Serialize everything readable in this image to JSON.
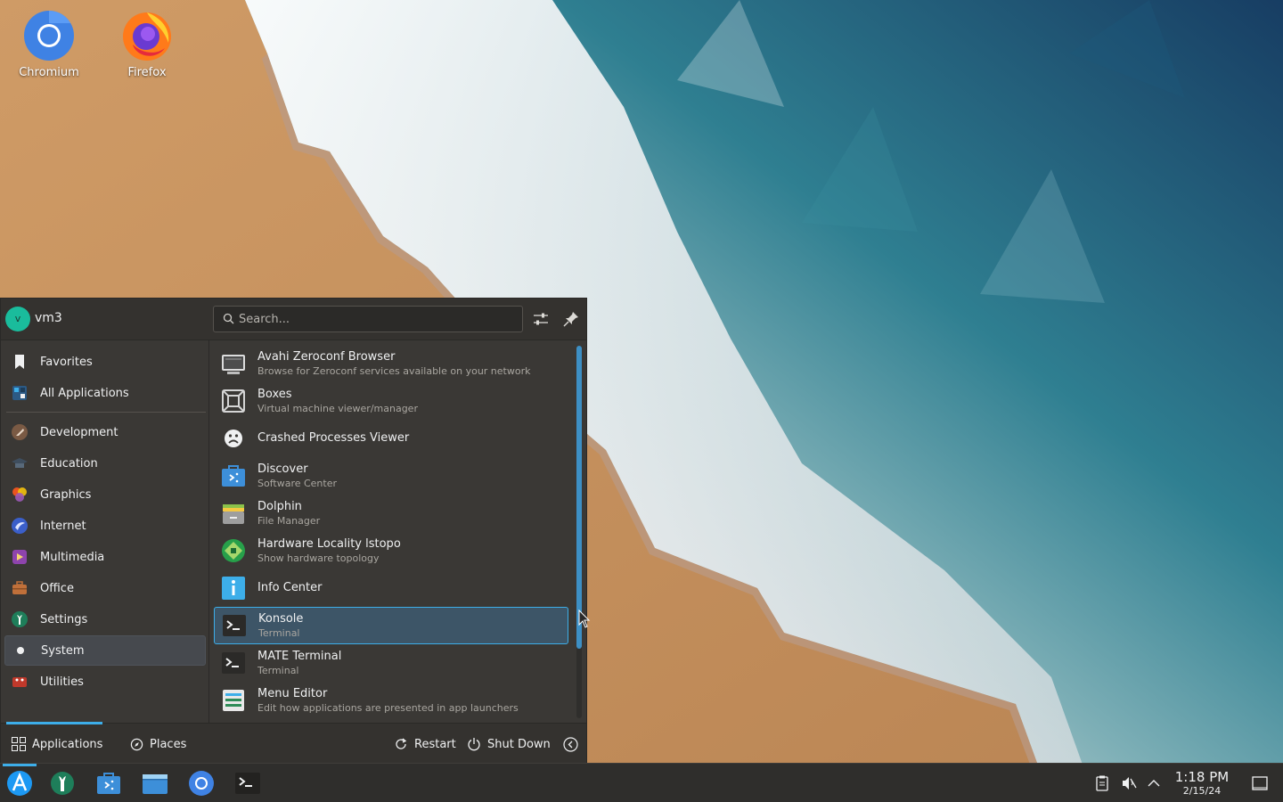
{
  "desktop": {
    "icons": [
      {
        "label": "Chromium",
        "icon": "chromium-icon"
      },
      {
        "label": "Firefox",
        "icon": "firefox-icon"
      }
    ]
  },
  "launcher": {
    "user": {
      "initial": "v",
      "name": "vm3"
    },
    "search": {
      "placeholder": "Search..."
    },
    "header_buttons": {
      "configure": "sliders-icon",
      "pin": "pin-icon"
    },
    "categories": [
      {
        "label": "Favorites",
        "icon": "bookmark-icon"
      },
      {
        "label": "All Applications",
        "icon": "all-apps-icon"
      },
      {
        "label": "Development",
        "icon": "development-icon"
      },
      {
        "label": "Education",
        "icon": "education-icon"
      },
      {
        "label": "Graphics",
        "icon": "graphics-icon"
      },
      {
        "label": "Internet",
        "icon": "internet-icon"
      },
      {
        "label": "Multimedia",
        "icon": "multimedia-icon"
      },
      {
        "label": "Office",
        "icon": "office-icon"
      },
      {
        "label": "Settings",
        "icon": "settings-icon"
      },
      {
        "label": "System",
        "icon": "system-icon",
        "selected": true
      },
      {
        "label": "Utilities",
        "icon": "utilities-icon"
      }
    ],
    "apps": [
      {
        "name": "Avahi Zeroconf Browser",
        "desc": "Browse for Zeroconf services available on your network",
        "icon": "network-monitor-icon"
      },
      {
        "name": "Boxes",
        "desc": "Virtual machine viewer/manager",
        "icon": "boxes-icon"
      },
      {
        "name": "Crashed Processes Viewer",
        "desc": "",
        "icon": "sad-face-icon"
      },
      {
        "name": "Discover",
        "desc": "Software Center",
        "icon": "discover-icon"
      },
      {
        "name": "Dolphin",
        "desc": "File Manager",
        "icon": "dolphin-icon"
      },
      {
        "name": "Hardware Locality lstopo",
        "desc": "Show hardware topology",
        "icon": "hwloc-icon"
      },
      {
        "name": "Info Center",
        "desc": "",
        "icon": "info-icon"
      },
      {
        "name": "Konsole",
        "desc": "Terminal",
        "icon": "konsole-icon",
        "selected": true
      },
      {
        "name": "MATE Terminal",
        "desc": "Terminal",
        "icon": "terminal-icon"
      },
      {
        "name": "Menu Editor",
        "desc": "Edit how applications are presented in app launchers",
        "icon": "menu-editor-icon"
      }
    ],
    "footer": {
      "tabs": [
        {
          "label": "Applications",
          "icon": "grid-icon",
          "active": true
        },
        {
          "label": "Places",
          "icon": "compass-icon"
        }
      ],
      "restart": "Restart",
      "shutdown": "Shut Down"
    }
  },
  "taskbar": {
    "launchers": [
      "launcher-icon",
      "system-settings-icon",
      "discover-icon",
      "dolphin-icon",
      "chromium-icon",
      "konsole-icon"
    ],
    "tray": [
      "clipboard-icon",
      "volume-muted-icon",
      "chevron-up-icon"
    ],
    "clock": {
      "time": "1:18 PM",
      "date": "2/15/24"
    },
    "show_desktop": "show-desktop-icon"
  },
  "colors": {
    "accent": "#3daee9",
    "panel": "#3a3835",
    "taskbar": "#2f2e2c"
  }
}
